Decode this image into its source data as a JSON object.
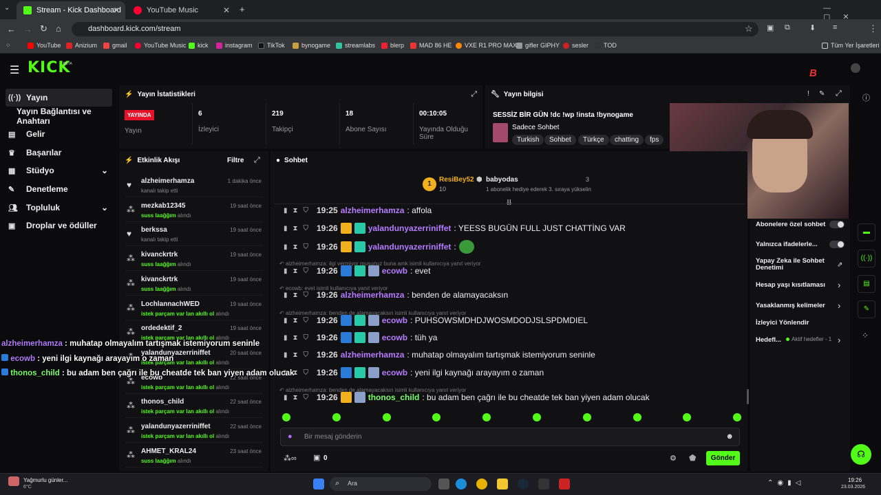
{
  "browser": {
    "tabs": [
      {
        "label": "Stream - Kick Dashboard"
      },
      {
        "label": "YouTube Music"
      }
    ],
    "url": "dashboard.kick.com/stream",
    "bookmarks": [
      "YouTube",
      "Anizium",
      "gmail",
      "YouTube Music",
      "kick",
      "instagram",
      "TikTok",
      "bynogame",
      "streamlabs",
      "blerp",
      "MAD 86 HE",
      "VXE R1 PRO MAX",
      "gifler GIPHY",
      "sesler",
      "TOD"
    ],
    "all_bookmarks": "Tüm Yer İşaretleri"
  },
  "kick": {
    "logo": "KICK",
    "beta": "BETA",
    "sidebar": [
      {
        "label": "Yayın"
      },
      {
        "label": "Yayın Bağlantısı ve Anahtarı"
      },
      {
        "label": "Gelir"
      },
      {
        "label": "Başarılar"
      },
      {
        "label": "Stüdyo"
      },
      {
        "label": "Denetleme"
      },
      {
        "label": "Topluluk"
      },
      {
        "label": "Droplar ve ödüller"
      }
    ],
    "stats": {
      "title": "Yayın İstatistikleri",
      "live": "YAYINDA",
      "live_label": "Yayın",
      "viewers": "6",
      "viewers_label": "İzleyici",
      "followers": "219",
      "followers_label": "Takipçi",
      "subs": "18",
      "subs_label": "Abone Sayısı",
      "uptime": "00:10:05",
      "uptime_label": "Yayında Olduğu Süre"
    },
    "info": {
      "title": "Yayın bilgisi",
      "stream_title": "SESSİZ BİR GÜN !dc !wp !insta !bynogame",
      "category": "Sadece Sohbet",
      "tags": [
        "Turkish",
        "Sohbet",
        "Türkçe",
        "chatting",
        "fps"
      ]
    },
    "activity": {
      "title": "Etkinlik Akışı",
      "filter": "Filtre",
      "items": [
        {
          "name": "alzheimerhamza",
          "sub": "kanalı takip etti",
          "time": "1 dakika önce"
        },
        {
          "name": "mezkab12345",
          "sub_b": "suss laağğım",
          "sub": "alındı",
          "time": "19 saat önce"
        },
        {
          "name": "berkssa",
          "sub": "kanalı takip etti",
          "time": "19 saat önce"
        },
        {
          "name": "kivanckrtrk",
          "sub_b": "suss laağğım",
          "sub": "alındı",
          "time": "19 saat önce"
        },
        {
          "name": "kivanckrtrk",
          "sub_b": "suss laağğım",
          "sub": "alındı",
          "time": "19 saat önce"
        },
        {
          "name": "LochlannachWED",
          "sub_b": "istek parçam var lan akıllı ol",
          "sub": "alındı",
          "time": "19 saat önce"
        },
        {
          "name": "ordedektif_2",
          "sub_b": "istek parçam var lan akıllı ol",
          "sub": "alındı",
          "time": "19 saat önce"
        },
        {
          "name": "yalandunyazerriniffet",
          "sub_b": "istek parçam var lan akıllı ol",
          "sub": "alındı",
          "time": "20 saat önce"
        },
        {
          "name": "ecowb",
          "sub_b": "istek parçam var lan akıllı ol",
          "sub": "alındı",
          "time": "22 saat önce"
        },
        {
          "name": "thonos_child",
          "sub_b": "istek parçam var lan akıllı ol",
          "sub": "alındı",
          "time": "22 saat önce"
        },
        {
          "name": "yalandunyazerriniffet",
          "sub_b": "istek parçam var lan akıllı ol",
          "sub": "alındı",
          "time": "22 saat önce"
        },
        {
          "name": "AHMET_KRAL24",
          "sub_b": "suss laağğım",
          "sub": "alındı",
          "time": "23 saat önce"
        }
      ]
    },
    "chat": {
      "title": "Sohbet",
      "pinned_user1": "ResiBey52",
      "pinned_count1": "10",
      "pinned_user2": "babyodas",
      "pinned_count2": "3",
      "pinned_note": "1 abonelik hediye ederek 3. sıraya yükselin",
      "messages": [
        {
          "time": "19:25",
          "user": "alzheimerhamza",
          "text": ": affola",
          "color": "#b57bff"
        },
        {
          "time": "19:26",
          "user": "yalandunyazerriniffet",
          "text": ": YEESS BUGÜN FULL JUST CHATTİNG VAR",
          "color": "#b57bff"
        },
        {
          "time": "19:26",
          "user": "yalandunyazerriniffet",
          "text": ":",
          "color": "#b57bff"
        },
        {
          "reply": "alzheimerhamza: ilgi vermiyor musunuz buna amk isimli kullanıcıya yanıt veriyor"
        },
        {
          "time": "19:26",
          "user": "ecowb",
          "text": ": evet",
          "color": "#b57bff"
        },
        {
          "reply": "ecowb: evet isimli kullanıcıya yanıt veriyor"
        },
        {
          "time": "19:26",
          "user": "alzheimerhamza",
          "text": ": benden de alamayacaksın",
          "color": "#b57bff"
        },
        {
          "reply": "alzheimerhamza: benden de alamayacaksın isimli kullanıcıya yanıt veriyor"
        },
        {
          "time": "19:26",
          "user": "ecowb",
          "text": ": PUHSOWSMDHDJWOSMDODJSLSPDMDIEL",
          "color": "#b57bff"
        },
        {
          "time": "19:26",
          "user": "ecowb",
          "text": ": tüh ya",
          "color": "#b57bff"
        },
        {
          "time": "19:26",
          "user": "alzheimerhamza",
          "text": ": muhatap olmayalım tartışmak istemiyorum seninle",
          "color": "#b57bff"
        },
        {
          "time": "19:26",
          "user": "ecowb",
          "text": ": yeni ilgi kaynağı arayayım o zaman",
          "color": "#b57bff"
        },
        {
          "reply": "alzheimerhamza: benden de alamayacaksın isimli kullanıcıya yanıt veriyor"
        },
        {
          "time": "19:26",
          "user": "thonos_child",
          "text": ": bu adam ben çağrı ile bu cheatde tek ban yiyen adam olucak",
          "color": "#7cff6b"
        }
      ],
      "placeholder": "Bir mesaj gönderin",
      "points": "0",
      "send": "Gönder"
    },
    "settings": [
      {
        "label": "Abonelere özel sohbet"
      },
      {
        "label": "Yalnızca ifadelerle..."
      },
      {
        "label": "Yapay Zeka ile Sohbet Denetimi"
      },
      {
        "label": "Hesap yaşı kısıtlaması"
      },
      {
        "label": "Yasaklanmış kelimeler"
      },
      {
        "label": "İzleyici Yönlendir"
      },
      {
        "label": "Hedefl..."
      }
    ],
    "goals": "Aktif hedefler - 1",
    "overlay": [
      {
        "user": "alzheimerhamza",
        "text": " : muhatap olmayalım tartışmak istemiyorum seninle",
        "color": "#b57bff"
      },
      {
        "user": "ecowb",
        "text": " : yeni ilgi kaynağı arayayım o zaman",
        "color": "#b57bff"
      },
      {
        "user": "thonos_child",
        "text": " : bu adam ben çağrı ile bu cheatde tek ban yiyen adam olucak",
        "color": "#7cff6b"
      }
    ]
  },
  "taskbar": {
    "weather": "Yağmurlu günler...",
    "temp": "6°C",
    "search": "Ara",
    "time": "19:26",
    "date": "23.03.2026"
  }
}
